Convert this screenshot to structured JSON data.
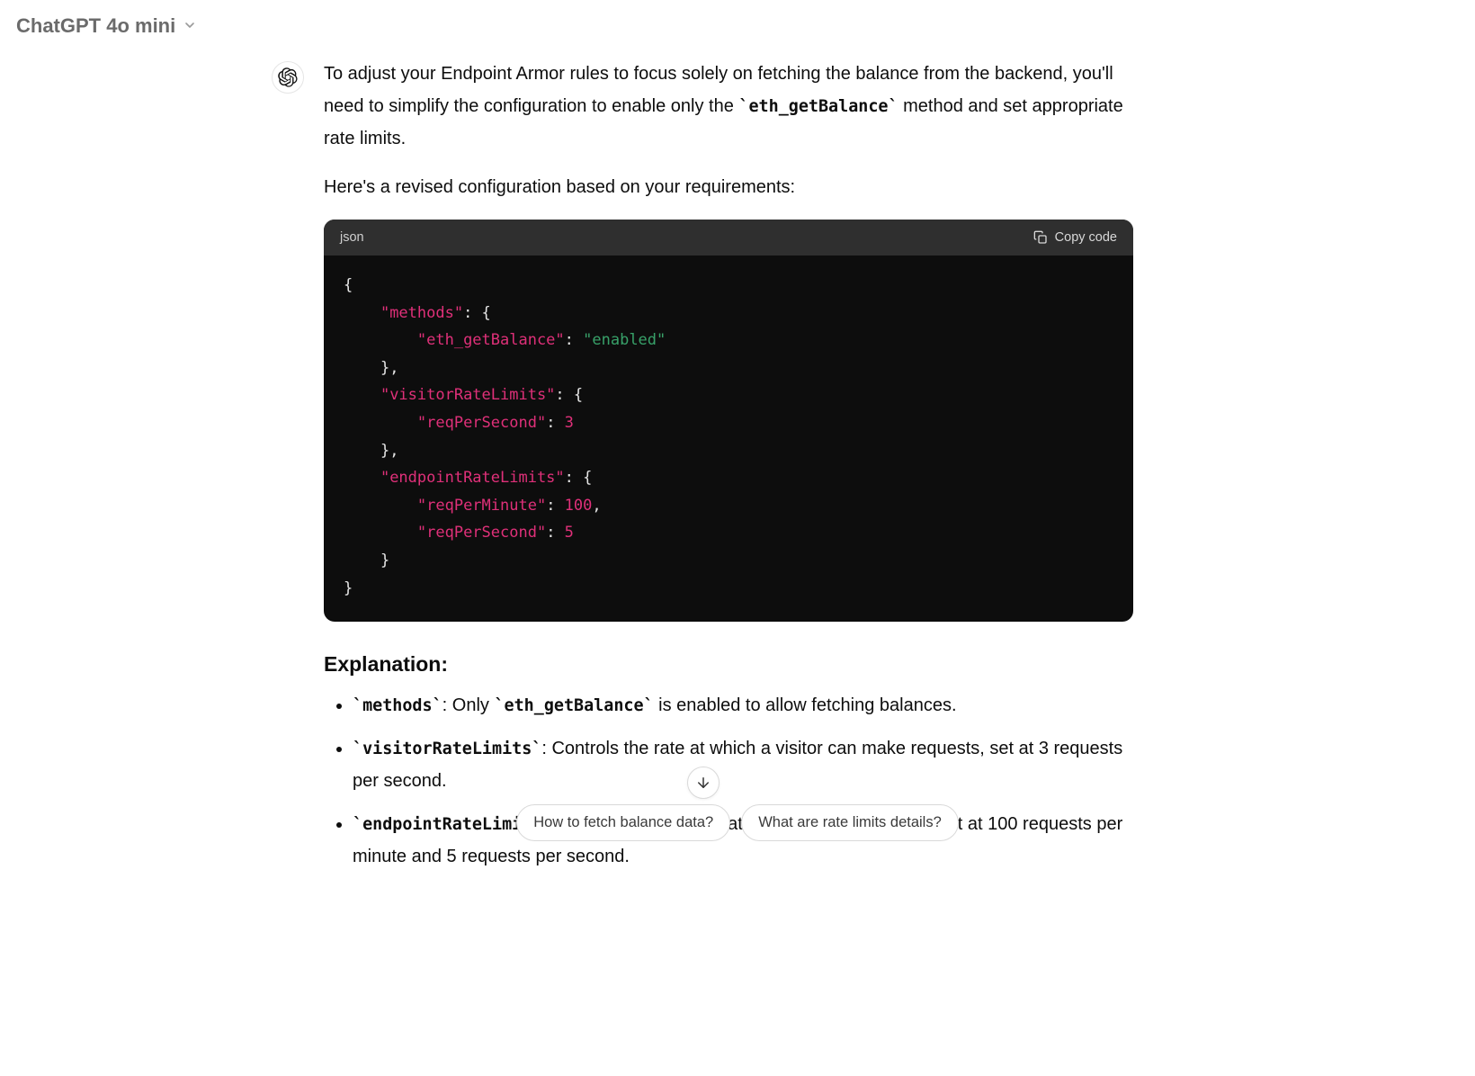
{
  "header": {
    "model_name": "ChatGPT 4o mini"
  },
  "message": {
    "paragraph1_pre": "To adjust your Endpoint Armor rules to focus solely on fetching the balance from the backend, you'll need to simplify the configuration to enable only the ",
    "paragraph1_code": "`eth_getBalance`",
    "paragraph1_post": " method and set appropriate rate limits.",
    "paragraph2": "Here's a revised configuration based on your requirements:"
  },
  "codeblock": {
    "language": "json",
    "copy_label": "Copy code",
    "tokens": {
      "k_methods": "\"methods\"",
      "k_eth": "\"eth_getBalance\"",
      "v_enabled": "\"enabled\"",
      "k_visitor": "\"visitorRateLimits\"",
      "k_reqPerSecond": "\"reqPerSecond\"",
      "v_3": "3",
      "k_endpoint": "\"endpointRateLimits\"",
      "k_reqPerMinute": "\"reqPerMinute\"",
      "v_100": "100",
      "v_5": "5"
    }
  },
  "explanation": {
    "heading": "Explanation:",
    "items": [
      {
        "code": "`methods`",
        "text_pre": ": Only ",
        "code2": "`eth_getBalance`",
        "text_post": " is enabled to allow fetching balances."
      },
      {
        "code": "`visitorRateLimits`",
        "text_pre": ": Controls the rate at which a visitor can make requests, set at 3 requests per second.",
        "code2": "",
        "text_post": ""
      },
      {
        "code": "`endpointRateLimits`",
        "text_pre": ": Controls the overall rate limits for the endpoint, set at 100 requests per minute and 5 requests per second.",
        "code2": "",
        "text_post": ""
      }
    ]
  },
  "suggestions": {
    "s1": "How to fetch balance data?",
    "s2": "What are rate limits details?"
  }
}
